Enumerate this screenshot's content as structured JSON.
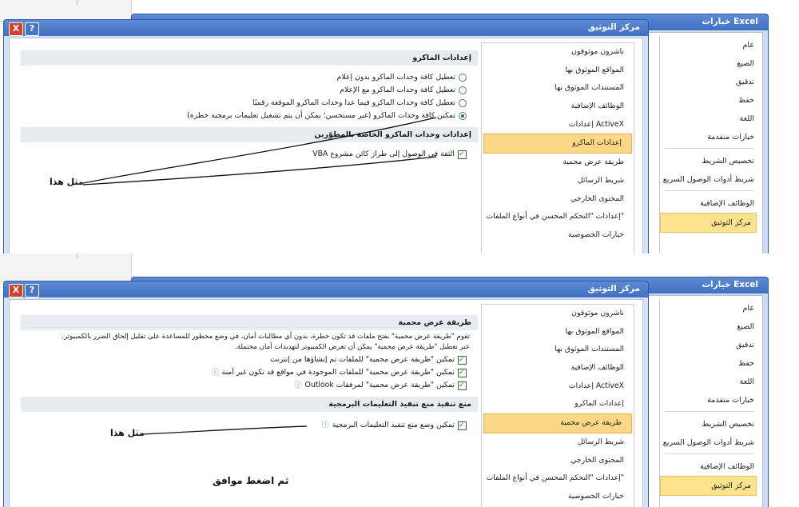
{
  "excel_options": {
    "title": "خيارات Excel",
    "nav": [
      "عام",
      "الصيغ",
      "تدقيق",
      "حفظ",
      "اللغة",
      "خيارات متقدمة",
      "تخصيص الشريط",
      "شريط أدوات الوصول السريع",
      "الوظائف الإضافية",
      "مركز التوثيق"
    ]
  },
  "trust_center": {
    "title": "مركز التوثيق",
    "help_icon": "?",
    "close_icon": "X",
    "nav": [
      "ناشرون موثوقون",
      "المواقع الموثوق بها",
      "المستندات الموثوق بها",
      "الوظائف الإضافية",
      "إعدادات ActiveX",
      "إعدادات الماكرو",
      "طريقة عرض محمية",
      "شريط الرسائل",
      "المحتوى الخارجي",
      "إعدادات \"التحكم المحسن في أنواع الملفات\"",
      "خيارات الخصوصية"
    ]
  },
  "panel1": {
    "selected_nav": "إعدادات الماكرو",
    "macro_section": "إعدادات الماكرو",
    "radios": [
      {
        "label": "تعطيل كافة وحدات الماكرو بدون إعلام",
        "checked": false
      },
      {
        "label": "تعطيل كافة وحدات الماكرو مع الإعلام",
        "checked": false
      },
      {
        "label": "تعطيل كافة وحدات الماكرو فيما عدا وحدات الماكرو الموقعة رقميًا",
        "checked": false
      },
      {
        "label": "تمكين كافة وحدات الماكرو (غير مستحسن؛ يمكن أن يتم تشغيل تعليمات برمجية خطرة)",
        "checked": true
      }
    ],
    "dev_section": "إعدادات وحدات الماكرو الخاصة بالمطوّرين",
    "vba_checkbox": "الثقة في الوصول إلى طراز كائن مشروع VBA",
    "annotation": "مثل هذا"
  },
  "panel2": {
    "selected_nav": "طريقة عرض محمية",
    "section": "طريقة عرض محمية",
    "description_1": "تقوم \"طريقة عرض محمية\" بفتح ملفات قد تكون خطرة، بدون أي مطالبات أمان، في وضع محظور للمساعدة على تقليل إلحاق الضرر بالكمبيوتر.",
    "description_2": "عبر تعطيل \"طريقة عرض محمية\" يمكن أن تعرض الكمبيوتر لتهديدات أمان محتملة.",
    "checkboxes": [
      "تمكين \"طريقة عرض محمية\" للملفات تم إنشاؤها من إنترنت",
      "تمكين \"طريقة عرض محمية\" للملفات الموجودة في مواقع قد تكون غير آمنة",
      "تمكين \"طريقة عرض محمية\" لمرفقات Outlook"
    ],
    "prevent_section": "منع تنفيذ منع تنفيذ التعليمات البرمجية",
    "prevent_checkbox": "تمكين وضع منع تنفيذ التعليمات البرمجية",
    "annotation": "مثل هذا",
    "annotation_ok": "ثم اضغط موافق"
  }
}
